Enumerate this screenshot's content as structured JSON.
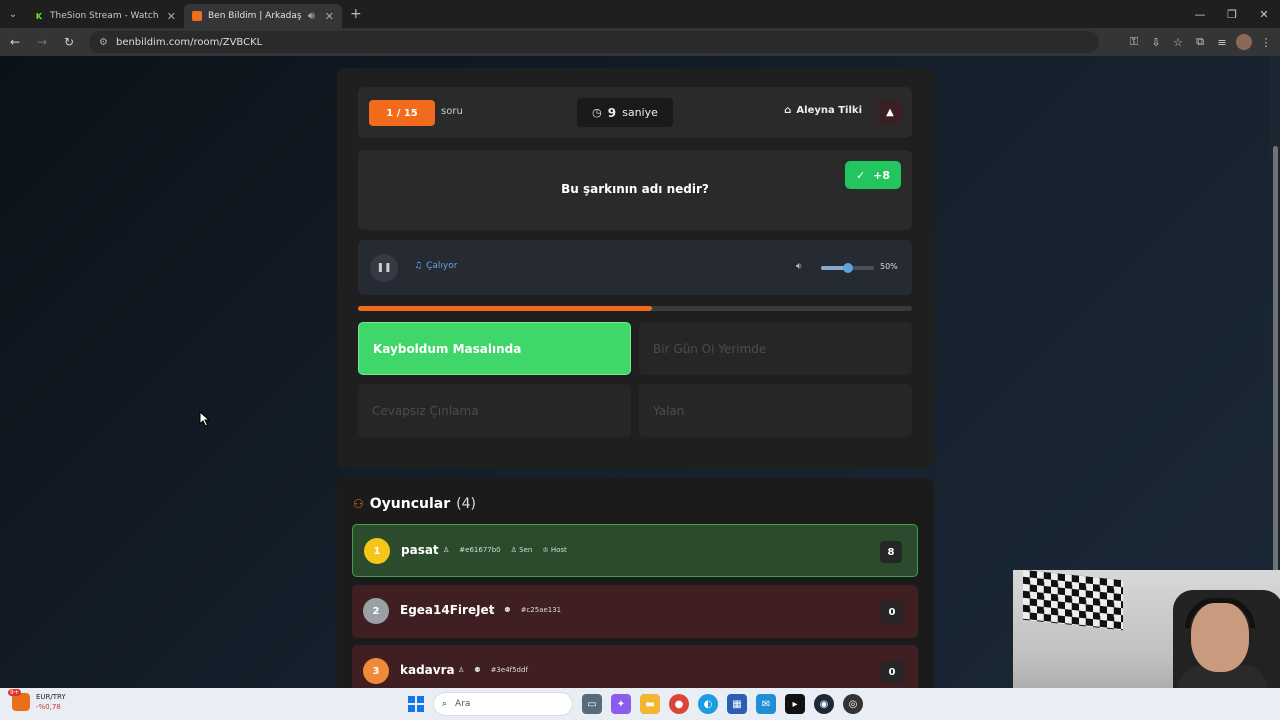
{
  "browser": {
    "tabs": [
      {
        "title": "TheSion Stream - Watch Live on",
        "favicon_color": "#53fc18"
      },
      {
        "title": "Ben Bildim | Arkadaşlarınla",
        "favicon_color": "#f26b1d"
      }
    ],
    "url": "benbildim.com/room/ZVBCKL"
  },
  "game": {
    "question_counter": "1 / 15",
    "question_counter_suffix": "soru",
    "timer_value": "9",
    "timer_unit": "saniye",
    "category": "Aleyna Tilki",
    "question": "Bu şarkının adı nedir?",
    "score_gain": "+8",
    "audio": {
      "status": "Çalıyor",
      "volume_label": "50%",
      "volume": 0.5
    },
    "progress": 0.53,
    "answers": [
      {
        "text": "Kayboldum Masalında",
        "state": "correct"
      },
      {
        "text": "Bir Gün Oi Yerimde",
        "state": "disabled"
      },
      {
        "text": "Cevapsız Çınlama",
        "state": "disabled"
      },
      {
        "text": "Yalan",
        "state": "disabled"
      }
    ]
  },
  "players": {
    "title": "Oyuncular",
    "count": "(4)",
    "list": [
      {
        "rank": "1",
        "name": "pasat",
        "id": "#e61677b0",
        "you_label": "Sen",
        "host_label": "Host",
        "score": "8",
        "rank_color": "#f5c518"
      },
      {
        "rank": "2",
        "name": "Egea14FireJet",
        "id": "#c25ae131",
        "score": "0",
        "rank_color": "#9aa0a6"
      },
      {
        "rank": "3",
        "name": "kadavra",
        "id": "#3e4f5ddf",
        "score": "0",
        "rank_color": "#f08a3a"
      }
    ]
  },
  "taskbar": {
    "ticker_name": "EUR/TRY",
    "ticker_value": "-%0,78",
    "ticker_badge": "9+",
    "search_placeholder": "Ara"
  }
}
